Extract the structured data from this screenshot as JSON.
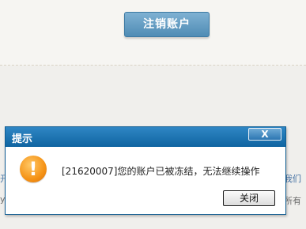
{
  "page": {
    "cancel_account_label": "注销账户",
    "edge_left_top": "开",
    "edge_left_bottom": "y",
    "edge_right_top": "我们",
    "edge_right_bottom": "所有"
  },
  "dialog": {
    "title": "提示",
    "close_glyph": "X",
    "icon_glyph": "!",
    "message": "[21620007]您的账户已被冻结，无法继续操作",
    "close_button_label": "关闭"
  },
  "colors": {
    "titlebar": "#0f64a1",
    "primary_button": "#4f8cb5",
    "warning_icon": "#f59316"
  }
}
